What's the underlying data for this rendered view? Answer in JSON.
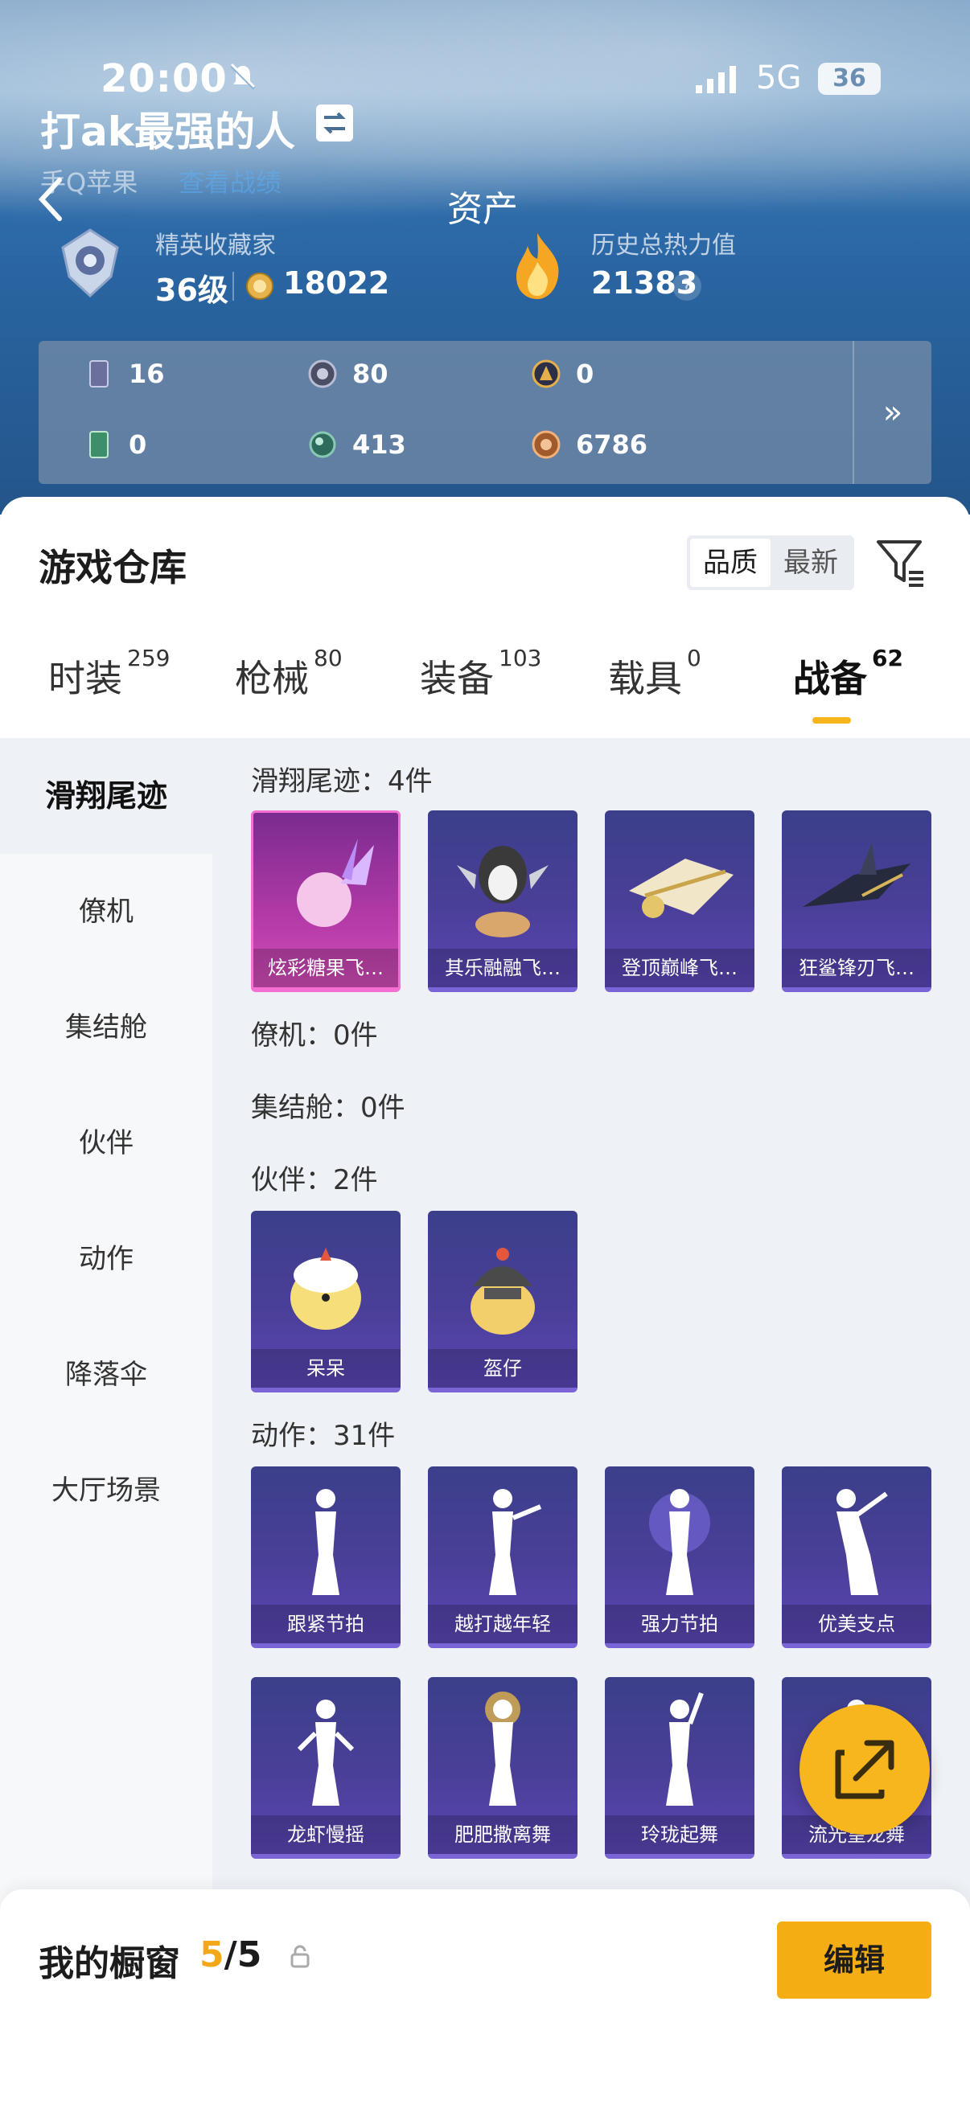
{
  "status": {
    "time": "20:00",
    "network": "5G",
    "battery": "36"
  },
  "profile": {
    "name": "打ak最强的人",
    "platform": "手Q苹果",
    "link": "查看战绩"
  },
  "header": {
    "title": "资产"
  },
  "rank": {
    "label": "精英收藏家",
    "level": "36级",
    "points": "18022"
  },
  "heat": {
    "label": "历史总热力值",
    "value": "21383",
    "help": "?"
  },
  "resources": [
    {
      "icon": "card-icon",
      "value": "16"
    },
    {
      "icon": "coin-silver-icon",
      "value": "80"
    },
    {
      "icon": "coin-gold-icon",
      "value": "0"
    },
    {
      "icon": "green-card-icon",
      "value": "0"
    },
    {
      "icon": "orb-icon",
      "value": "413"
    },
    {
      "icon": "bronze-coin-icon",
      "value": "6786"
    }
  ],
  "resources_more": "»",
  "warehouse": {
    "title": "游戏仓库",
    "sort_options": [
      "品质",
      "最新"
    ],
    "tabs": [
      {
        "label": "时装",
        "count": "259"
      },
      {
        "label": "枪械",
        "count": "80"
      },
      {
        "label": "装备",
        "count": "103"
      },
      {
        "label": "载具",
        "count": "0"
      },
      {
        "label": "战备",
        "count": "62"
      }
    ]
  },
  "sidebar": [
    "滑翔尾迹",
    "僚机",
    "集结舱",
    "伙伴",
    "动作",
    "降落伞",
    "大厅场景"
  ],
  "sections": {
    "trail": {
      "title": "滑翔尾迹：4件",
      "items": [
        "炫彩糖果飞…",
        "其乐融融飞…",
        "登顶巅峰飞…",
        "狂鲨锋刃飞…"
      ]
    },
    "wingman": {
      "title": "僚机：0件"
    },
    "pod": {
      "title": "集结舱：0件"
    },
    "partner": {
      "title": "伙伴：2件",
      "items": [
        "呆呆",
        "盔仔"
      ]
    },
    "action": {
      "title": "动作：31件",
      "items": [
        "跟紧节拍",
        "越打越年轻",
        "强力节拍",
        "优美支点",
        "龙虾慢摇",
        "肥肥撒离舞",
        "玲珑起舞",
        "流光皇龙舞"
      ]
    }
  },
  "showcase": {
    "label": "我的橱窗",
    "current": "5",
    "total": "/5",
    "edit": "编辑"
  },
  "colors": {
    "accent": "#f5ad14",
    "card": "#4a3f98",
    "card_pink": "#b33aa7"
  }
}
